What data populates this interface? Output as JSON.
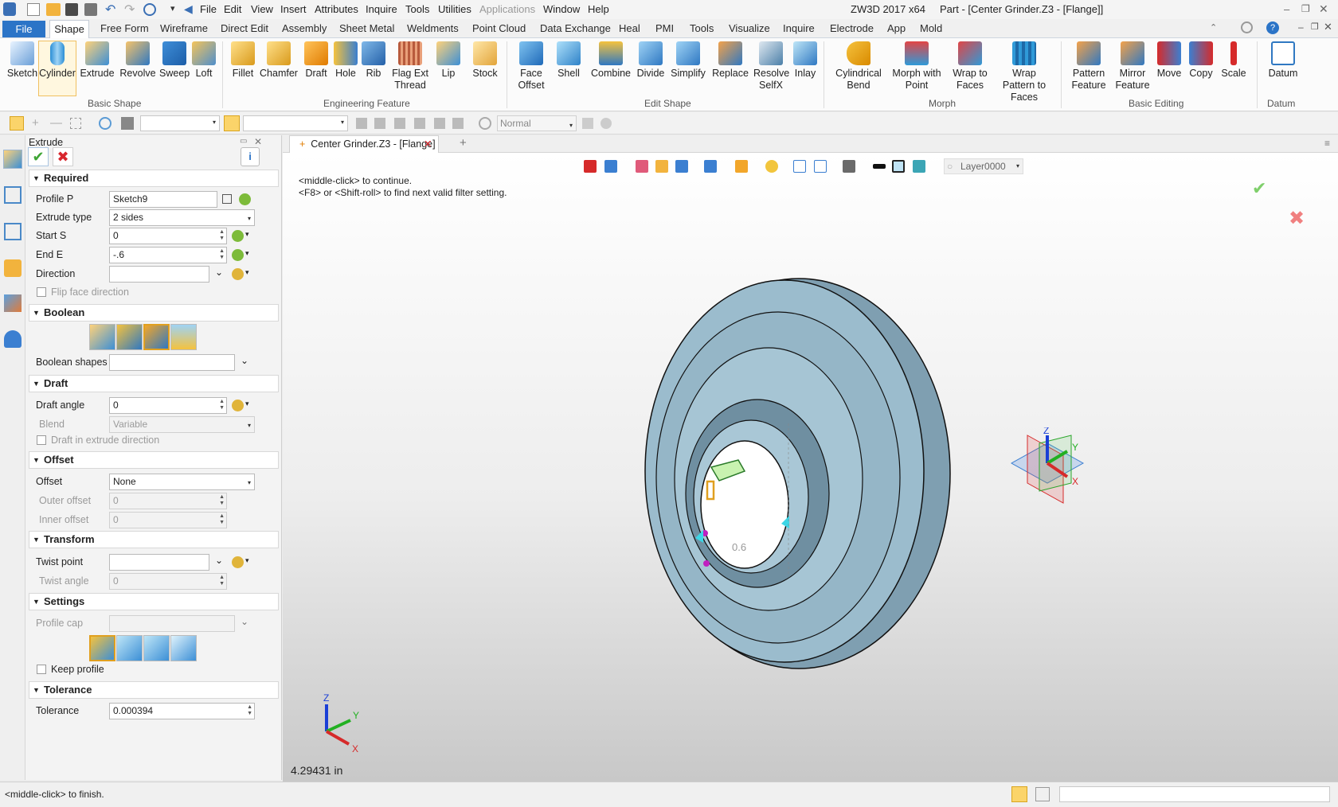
{
  "app": {
    "title": "ZW3D 2017  x64",
    "document_title": "Part - [Center Grinder.Z3 - [Flange]]"
  },
  "menubar": [
    "File",
    "Edit",
    "View",
    "Insert",
    "Attributes",
    "Inquire",
    "Tools",
    "Utilities",
    "Applications",
    "Window",
    "Help"
  ],
  "ribbon_tabs": [
    "File",
    "Shape",
    "Free Form",
    "Wireframe",
    "Direct Edit",
    "Assembly",
    "Sheet Metal",
    "Weldments",
    "Point Cloud",
    "Data Exchange",
    "Heal",
    "PMI",
    "Tools",
    "Visualize",
    "Inquire",
    "Electrode",
    "App",
    "Mold"
  ],
  "ribbon": {
    "basic_shape": {
      "label": "Basic Shape",
      "tools": [
        "Sketch",
        "Cylinder",
        "Extrude",
        "Revolve",
        "Sweep",
        "Loft"
      ]
    },
    "engineering_feature": {
      "label": "Engineering Feature",
      "tools": [
        "Fillet",
        "Chamfer",
        "Draft",
        "Hole",
        "Rib",
        "Flag Ext Thread",
        "Lip",
        "Stock"
      ]
    },
    "edit_shape": {
      "label": "Edit Shape",
      "tools": [
        "Face Offset",
        "Shell",
        "Combine",
        "Divide",
        "Simplify",
        "Replace",
        "Resolve SelfX",
        "Inlay"
      ]
    },
    "morph": {
      "label": "Morph",
      "tools": [
        "Cylindrical Bend",
        "Morph with Point",
        "Wrap to Faces",
        "Wrap Pattern to Faces"
      ]
    },
    "basic_editing": {
      "label": "Basic Editing",
      "tools": [
        "Pattern Feature",
        "Mirror Feature",
        "Move",
        "Copy",
        "Scale"
      ]
    },
    "datum": {
      "label": "Datum",
      "tools": [
        "Datum"
      ]
    }
  },
  "toolbar2": {
    "render_mode": "Normal"
  },
  "panel": {
    "title": "Extrude",
    "required": {
      "label": "Required",
      "profile_label": "Profile P",
      "profile_value": "Sketch9",
      "type_label": "Extrude type",
      "type_value": "2 sides",
      "start_label": "Start S",
      "start_value": "0",
      "end_label": "End E",
      "end_value": "-.6",
      "direction_label": "Direction",
      "direction_value": "",
      "flip_label": "Flip face direction"
    },
    "boolean": {
      "label": "Boolean",
      "shapes_label": "Boolean shapes",
      "shapes_value": ""
    },
    "draft": {
      "label": "Draft",
      "angle_label": "Draft angle",
      "angle_value": "0",
      "blend_label": "Blend",
      "blend_value": "Variable",
      "in_dir_label": "Draft in extrude direction"
    },
    "offset": {
      "label": "Offset",
      "offset_label": "Offset",
      "offset_value": "None",
      "outer_label": "Outer offset",
      "outer_value": "0",
      "inner_label": "Inner offset",
      "inner_value": "0"
    },
    "transform": {
      "label": "Transform",
      "twist_point_label": "Twist point",
      "twist_point_value": "",
      "twist_angle_label": "Twist angle",
      "twist_angle_value": "0"
    },
    "settings": {
      "label": "Settings",
      "profile_cap_label": "Profile cap",
      "keep_profile_label": "Keep profile"
    },
    "tolerance": {
      "label": "Tolerance",
      "tol_label": "Tolerance",
      "tol_value": "0.000394"
    }
  },
  "doc_tab": "Center Grinder.Z3 - [Flange]",
  "viewport": {
    "hint1": "<middle-click> to continue.",
    "hint2": "<F8> or <Shift-roll> to find next valid filter setting.",
    "layer": "Layer0000",
    "scale": "4.29431 in",
    "dim_label": "0.6",
    "axis_x": "X",
    "axis_y": "Y",
    "axis_z": "Z"
  },
  "status": {
    "hint": "<middle-click> to finish."
  },
  "colors": {
    "accent": "#2b74c7",
    "part": "#8fb2c4",
    "ok": "#3fa535",
    "cancel": "#d8262d"
  }
}
